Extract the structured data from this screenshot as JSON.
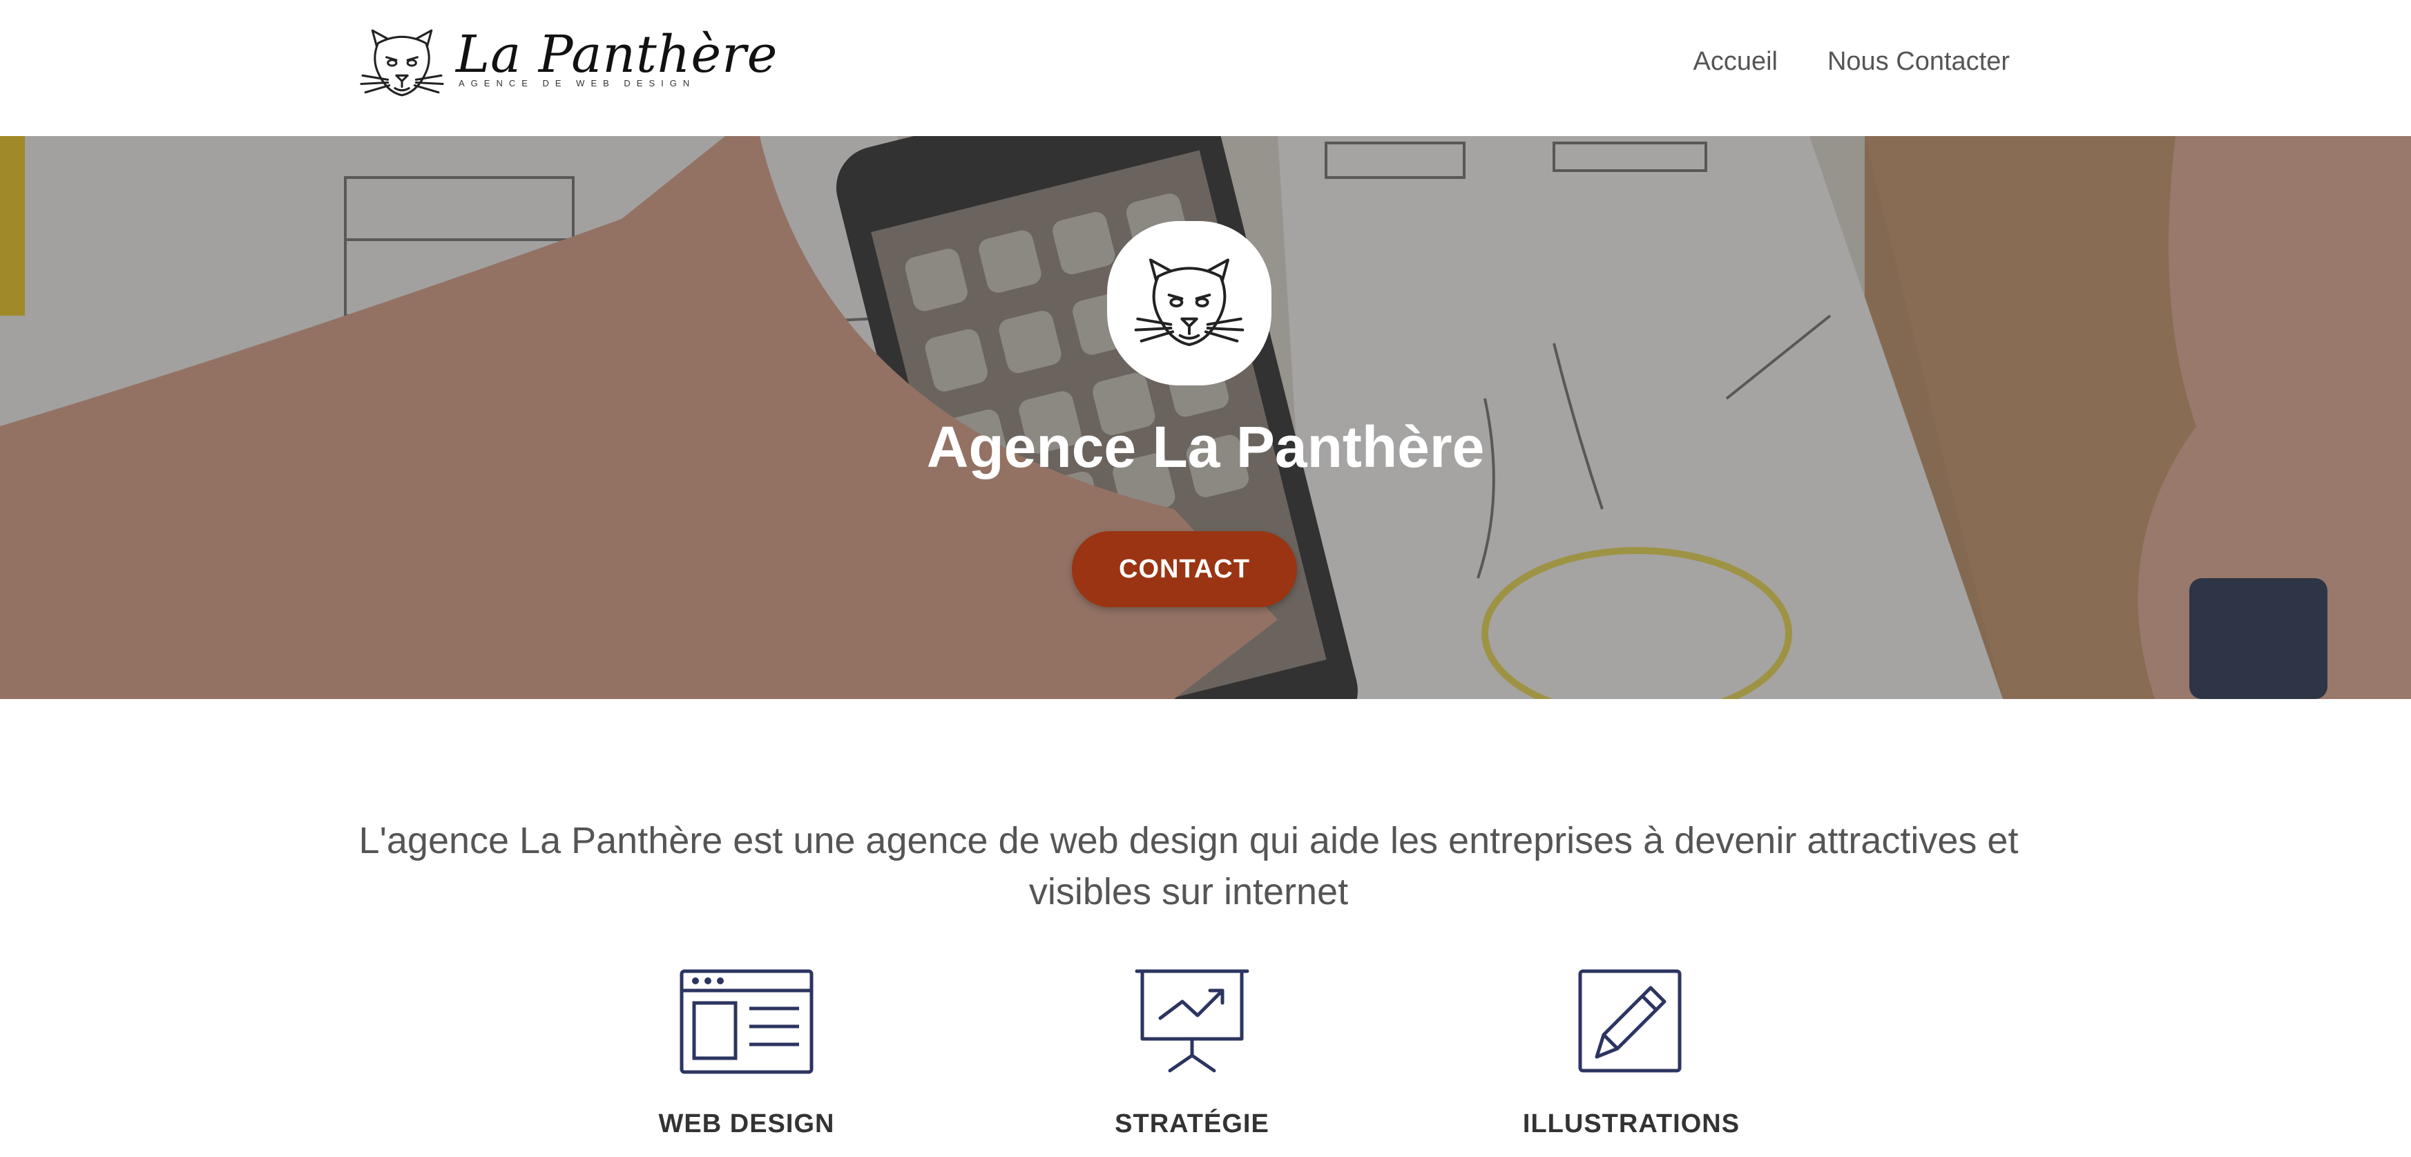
{
  "header": {
    "brand_name": "La Panthère",
    "brand_tagline": "AGENCE DE WEB DESIGN",
    "logo_icon": "panther-head-icon",
    "nav": [
      {
        "label": "Accueil"
      },
      {
        "label": "Nous Contacter"
      }
    ]
  },
  "hero": {
    "badge_icon": "panther-head-icon",
    "title": "Agence La Panthère",
    "button_label": "CONTACT",
    "button_color": "#9a3412"
  },
  "intro": {
    "text": "L'agence La Panthère est une agence de web design qui aide les entreprises à devenir attractives et visibles sur internet"
  },
  "services": [
    {
      "icon": "browser-window-icon",
      "label": "WEB DESIGN"
    },
    {
      "icon": "presentation-chart-icon",
      "label": "STRATÉGIE"
    },
    {
      "icon": "pencil-square-icon",
      "label": "ILLUSTRATIONS"
    }
  ],
  "colors": {
    "icon_color": "#2c3561",
    "text_gray": "#555555",
    "accent": "#9a3412"
  }
}
